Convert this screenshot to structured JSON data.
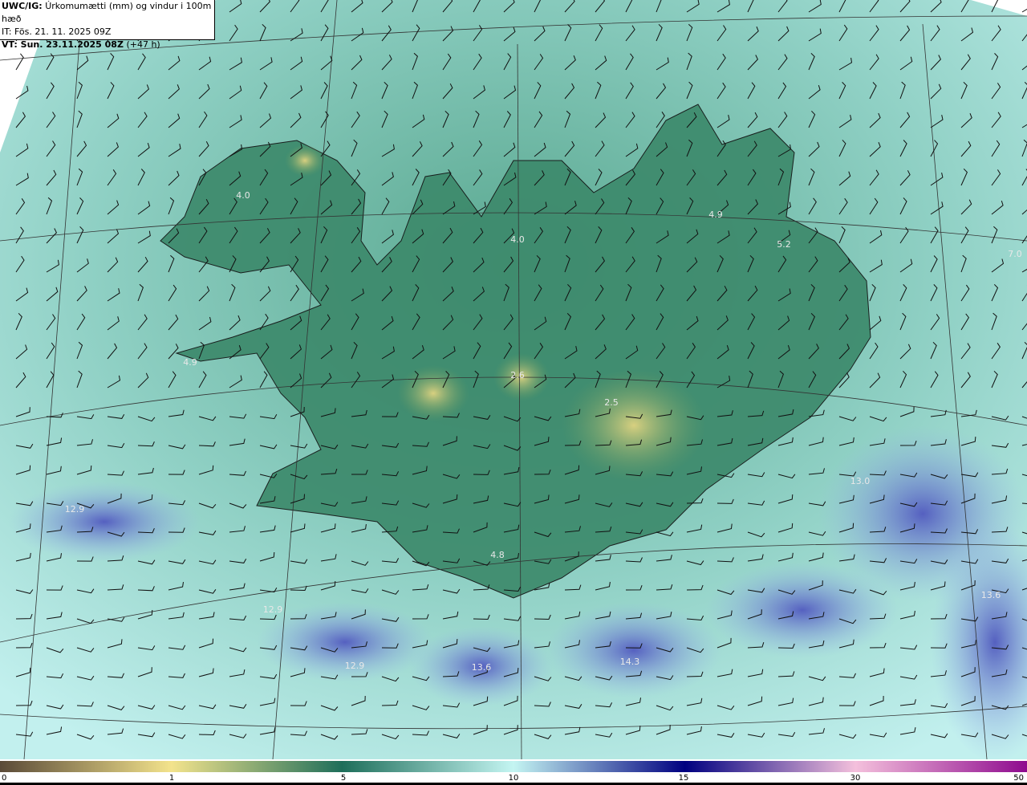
{
  "title": {
    "product": "UWC/IG:",
    "description": "Úrkomumætti (mm) og vindur i 100m hæð",
    "initial_time": "IT: Fös. 21. 11. 2025 09Z",
    "valid_time": "VT: Sun. 23.11.2025 08Z",
    "lead": "(+47 h)"
  },
  "map_labels": [
    "4.0",
    "4.0",
    "4.9",
    "5.2",
    "7.0",
    "4.9",
    "2.6",
    "2.5",
    "13.0",
    "13.6",
    "12.9",
    "4.8",
    "12.9",
    "12.9",
    "13.6",
    "14.3"
  ],
  "colorbar": {
    "ticks": [
      "0",
      "1",
      "5",
      "10",
      "15",
      "30",
      "50"
    ],
    "colors": [
      "#5a4a38",
      "#f3e38c",
      "#1e6e5a",
      "#c4f5f2",
      "#000080",
      "#f4c0dc",
      "#8e0a8e"
    ]
  }
}
